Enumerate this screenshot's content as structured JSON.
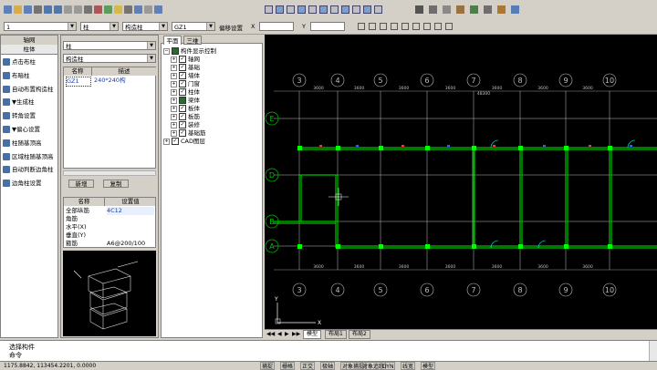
{
  "toolbar1": {
    "icons": [
      "new-icon",
      "open-icon",
      "save-icon",
      "print-icon",
      "undo-icon",
      "redo-icon",
      "copy-icon",
      "paste-icon",
      "find-icon",
      "cut-icon",
      "layer-icon",
      "lightbulb-icon",
      "settings-icon",
      "calc-icon",
      "report-icon",
      "view-icon"
    ],
    "right_icons": [
      "select-icon",
      "copy-icon",
      "mirror-icon",
      "move-icon",
      "delete-icon",
      "rotate-icon",
      "stretch-icon",
      "trim-icon",
      "extend-icon",
      "break-icon",
      "align-icon"
    ],
    "far_icons": [
      "binoculars-icon",
      "pan-icon",
      "zoom-icon",
      "zoom-window-icon",
      "zoom-extent-icon",
      "measure-icon",
      "ruler-icon",
      "layer-table-icon"
    ]
  },
  "toolbar2": {
    "floor_select": "1",
    "category_select": "柱",
    "type_select": "构造柱",
    "member_select": "GZ1",
    "offset_label": "偏移设置",
    "x_label": "X",
    "y_label": "Y",
    "x_value": "",
    "y_value": ""
  },
  "left_nav": {
    "header": "轴网",
    "selected": "柱体",
    "items": [
      "点击布柱",
      "布暗柱",
      "自动布置构造柱",
      "▼生成柱",
      "转角设置",
      "▼偏心设置",
      "柱随基顶高",
      "区域柱随基顶高",
      "自动判断边角柱",
      "边角柱设置"
    ]
  },
  "member_panel": {
    "category": "柱",
    "type": "构造柱",
    "col_name": "名称",
    "col_desc": "描述",
    "rows": [
      {
        "name": "GZ1",
        "desc": "240*240构"
      }
    ],
    "new_button": "新增",
    "copy_button": "复制",
    "prop_col_name": "名称",
    "prop_col_value": "设置值",
    "props": [
      {
        "name": "全部纵筋",
        "value": "4C12"
      },
      {
        "name": "角筋",
        "value": ""
      },
      {
        "name": "水平(X)",
        "value": ""
      },
      {
        "name": "垂直(Y)",
        "value": ""
      },
      {
        "name": "箍筋",
        "value": "A6@200/100"
      }
    ]
  },
  "tree_panel": {
    "tab_plan": "平面",
    "tab_3d": "三维",
    "root": "构件显示控制",
    "items": [
      "轴网",
      "基础",
      "墙体",
      "门窗",
      "柱体",
      "梁体",
      "板体",
      "板筋",
      "装修",
      "基础筋"
    ],
    "cad": "CAD图层"
  },
  "cad": {
    "axis_top": [
      "3",
      "4",
      "5",
      "6",
      "7",
      "8",
      "9",
      "10"
    ],
    "axis_bottom": [
      "3",
      "4",
      "5",
      "6",
      "7",
      "8",
      "9",
      "10"
    ],
    "axis_left": [
      "E",
      "D",
      "B",
      "A"
    ],
    "dims_top": [
      "3600",
      "3600",
      "3600",
      "3600",
      "3600",
      "3600",
      "3600"
    ],
    "total_dim": "48300",
    "tabs": [
      "模型",
      "布局1",
      "布局2"
    ]
  },
  "command": {
    "line1": "选择构件",
    "line2": "命令"
  },
  "status": {
    "coords": "1175.8842, 113454.2201, 0.0000",
    "items": [
      "捕捉",
      "栅格",
      "正交",
      "极轴",
      "对象捕捉",
      "对象追踪",
      "DYN",
      "线宽",
      "模型"
    ]
  },
  "colors": {
    "cad_bg": "#000000",
    "wall_green": "#00c000",
    "axis_white": "#c0c0c0",
    "ui_bg": "#d4d0c8"
  }
}
